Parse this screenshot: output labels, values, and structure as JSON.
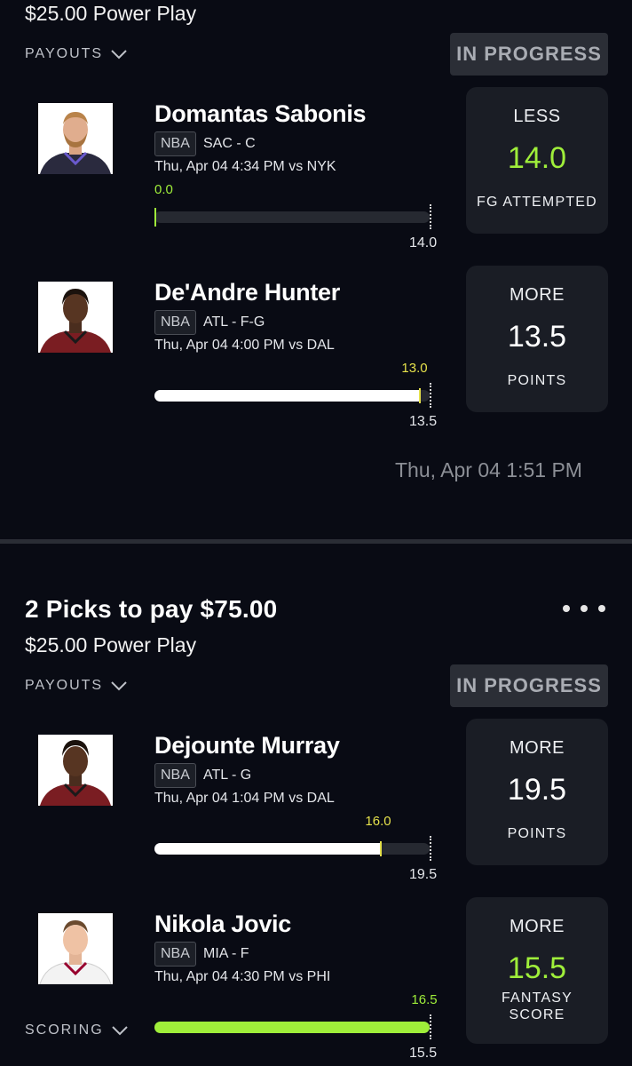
{
  "colors": {
    "accent_green": "#9fee3a",
    "marker_yellow": "#e5e14b",
    "background": "#090b14",
    "panel": "#1a1d25"
  },
  "entries": [
    {
      "play_line": "$25.00 Power Play",
      "payouts_label": "PAYOUTS",
      "status": "IN PROGRESS",
      "picks": [
        {
          "name": "Domantas Sabonis",
          "league": "NBA",
          "team": "SAC - C",
          "game": "Thu, Apr 04 4:34 PM  vs NYK",
          "current": "0.0",
          "line": "14.0",
          "progress": 0.0,
          "direction": "LESS",
          "stat": "FG ATTEMPTED",
          "value_color": "green"
        },
        {
          "name": "De'Andre Hunter",
          "league": "NBA",
          "team": "ATL - F-G",
          "game": "Thu, Apr 04 4:00 PM  vs DAL",
          "current": "13.0",
          "line": "13.5",
          "progress": 0.963,
          "direction": "MORE",
          "stat": "POINTS",
          "value_color": "white"
        }
      ],
      "timestamp": "Thu, Apr 04 1:51 PM"
    },
    {
      "title": "2 Picks to pay $75.00",
      "play_line": "$25.00 Power Play",
      "payouts_label": "PAYOUTS",
      "status": "IN PROGRESS",
      "picks": [
        {
          "name": "Dejounte Murray",
          "league": "NBA",
          "team": "ATL - G",
          "game": "Thu, Apr 04 1:04 PM  vs DAL",
          "current": "16.0",
          "line": "19.5",
          "progress": 0.821,
          "direction": "MORE",
          "stat": "POINTS",
          "value_color": "white"
        },
        {
          "name": "Nikola Jovic",
          "league": "NBA",
          "team": "MIA - F",
          "game": "Thu, Apr 04 4:30 PM  vs PHI",
          "current": "16.5",
          "line": "15.5",
          "progress": 1.0,
          "direction": "MORE",
          "stat": "FANTASY\nSCORE",
          "value_color": "green"
        }
      ],
      "scoring_label": "SCORING"
    }
  ]
}
